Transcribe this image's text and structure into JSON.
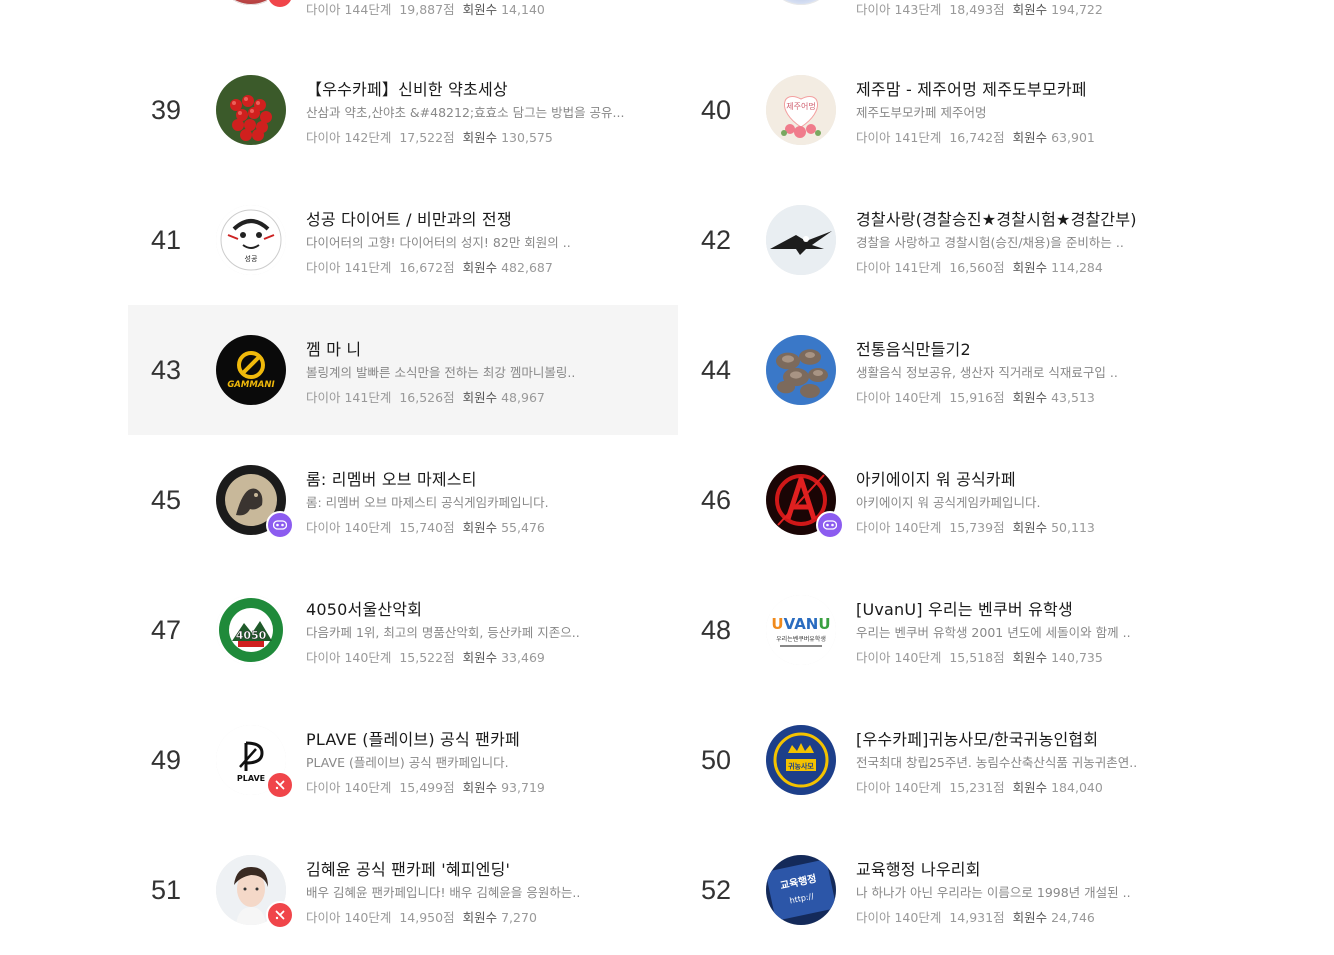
{
  "partial_top": [
    {
      "level": "다이아 144단계",
      "score": "19,887점",
      "members_label": "회원수",
      "members": "14,140"
    },
    {
      "level": "다이아 143단계",
      "score": "18,493점",
      "members_label": "회원수",
      "members": "194,722"
    }
  ],
  "cafes": [
    {
      "rank": "39",
      "title": "【우수카페】신비한 약초세상",
      "desc": "산삼과 약초,산야초 &#48212;효효소 담그는 방법을 공유...",
      "level": "다이아 142단계",
      "score": "17,522점",
      "members_label": "회원수",
      "members": "130,575",
      "icon": "red-berries-icon",
      "badge": ""
    },
    {
      "rank": "40",
      "title": "제주맘 - 제주어멍 제주도부모카페",
      "desc": "제주도부모카페 제주어멍",
      "level": "다이아 141단계",
      "score": "16,742점",
      "members_label": "회원수",
      "members": "63,901",
      "icon": "flower-heart-icon",
      "badge": ""
    },
    {
      "rank": "41",
      "title": "성공 다이어트 / 비만과의 전쟁",
      "desc": "다이어터의 고향! 다이어터의 성지! 82만 회원의 ..",
      "level": "다이아 141단계",
      "score": "16,672점",
      "members_label": "회원수",
      "members": "482,687",
      "icon": "cartoon-face-icon",
      "badge": ""
    },
    {
      "rank": "42",
      "title": "경찰사랑(경찰승진★경찰시험★경찰간부)",
      "desc": "경찰을 사랑하고 경찰시험(승진/채용)을 준비하는 ..",
      "level": "다이아 141단계",
      "score": "16,560점",
      "members_label": "회원수",
      "members": "114,284",
      "icon": "eagle-icon",
      "badge": ""
    },
    {
      "rank": "43",
      "title": "껨 마 니",
      "desc": "볼링계의 발빠른 소식만을 전하는 최강 껨마니볼링..",
      "level": "다이아 141단계",
      "score": "16,526점",
      "members_label": "회원수",
      "members": "48,967",
      "icon": "gammani-logo-icon",
      "badge": "",
      "highlight": true
    },
    {
      "rank": "44",
      "title": "전통음식만들기2",
      "desc": "생활음식 정보공유, 생산자 직거래로 식재료구입 ..",
      "level": "다이아 140단계",
      "score": "15,916점",
      "members_label": "회원수",
      "members": "43,513",
      "icon": "mushroom-icon",
      "badge": ""
    },
    {
      "rank": "45",
      "title": "롬: 리멤버 오브 마제스티",
      "desc": "롬: 리멤버 오브 마제스티 공식게임카페입니다.",
      "level": "다이아 140단계",
      "score": "15,740점",
      "members_label": "회원수",
      "members": "55,476",
      "icon": "moon-wolf-icon",
      "badge": "game"
    },
    {
      "rank": "46",
      "title": "아키에이지 워 공식카페",
      "desc": "아키에이지 워 공식게임카페입니다.",
      "level": "다이아 140단계",
      "score": "15,739점",
      "members_label": "회원수",
      "members": "50,113",
      "icon": "archeage-logo-icon",
      "badge": "game"
    },
    {
      "rank": "47",
      "title": "4050서울산악회",
      "desc": "다음카페 1위, 최고의 명품산악회, 등산카페 지존으..",
      "level": "다이아 140단계",
      "score": "15,522점",
      "members_label": "회원수",
      "members": "33,469",
      "icon": "hiking-club-logo-icon",
      "badge": ""
    },
    {
      "rank": "48",
      "title": "[UvanU] 우리는 벤쿠버 유학생",
      "desc": "우리는 벤쿠버 유학생 2001 년도에 세돌이와 함께 ..",
      "level": "다이아 140단계",
      "score": "15,518점",
      "members_label": "회원수",
      "members": "140,735",
      "icon": "uvanu-logo-icon",
      "badge": ""
    },
    {
      "rank": "49",
      "title": "PLAVE (플레이브) 공식 팬카페",
      "desc": "PLAVE (플레이브) 공식 팬카페입니다.",
      "level": "다이아 140단계",
      "score": "15,499점",
      "members_label": "회원수",
      "members": "93,719",
      "icon": "plave-logo-icon",
      "badge": "fan"
    },
    {
      "rank": "50",
      "title": "[우수카페]귀농사모/한국귀농인협회",
      "desc": "전국최대 창립25주년. 농림수산축산식품 귀농귀촌연..",
      "level": "다이아 140단계",
      "score": "15,231점",
      "members_label": "회원수",
      "members": "184,040",
      "icon": "farm-crest-icon",
      "badge": ""
    },
    {
      "rank": "51",
      "title": "김혜윤 공식 팬카페 '혜피엔딩'",
      "desc": "배우 김혜윤 팬카페입니다! 배우 김혜윤을 응원하는..",
      "level": "다이아 140단계",
      "score": "14,950점",
      "members_label": "회원수",
      "members": "7,270",
      "icon": "actress-photo-icon",
      "badge": "fan"
    },
    {
      "rank": "52",
      "title": "교육행정 나우리회",
      "desc": "나 하나가 아닌 우리라는 이름으로 1998년 개설된 ..",
      "level": "다이아 140단계",
      "score": "14,931점",
      "members_label": "회원수",
      "members": "24,746",
      "icon": "banner-photo-icon",
      "badge": ""
    }
  ],
  "colors": {
    "badge_fan": "#f0454a",
    "badge_game": "#8c5cf0",
    "highlight": "#f5f5f5"
  }
}
